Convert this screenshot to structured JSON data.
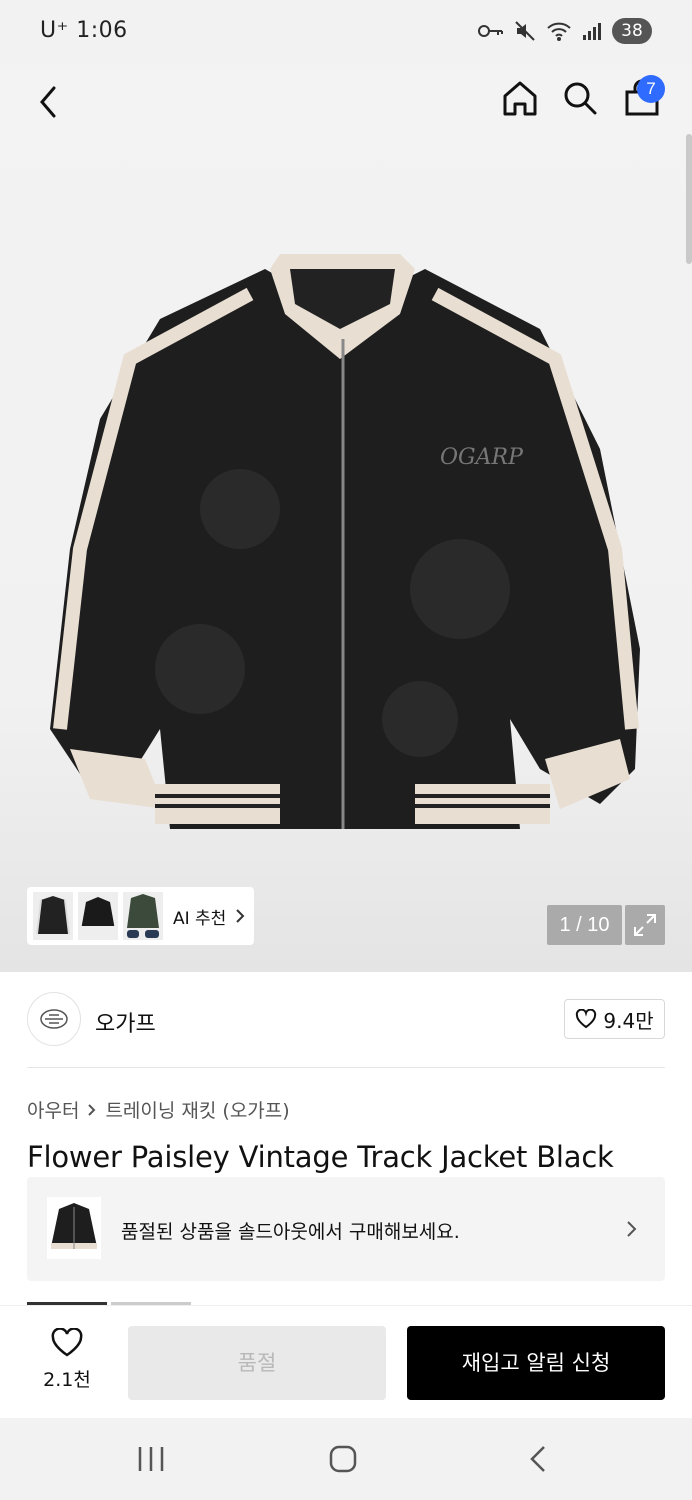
{
  "status": {
    "carrier": "U⁺ 1:06",
    "battery": "38"
  },
  "nav": {
    "cart_count": "7"
  },
  "gallery": {
    "counter": "1 / 10",
    "ai_label": "AI 추천"
  },
  "brand": {
    "name": "오가프",
    "likes": "9.4만"
  },
  "breadcrumb": {
    "category": "아우터",
    "subcategory": "트레이닝 재킷 (오가프)"
  },
  "product": {
    "title": "Flower Paisley Vintage Track Jacket Black"
  },
  "soldout_notice": {
    "text": "품절된 상품을 솔드아웃에서 구매해보세요."
  },
  "bottom": {
    "wish_count": "2.1천",
    "soldout_label": "품절",
    "restock_label": "재입고 알림 신청"
  },
  "colors": {
    "accent_badge": "#2f6bff",
    "primary_button": "#000000",
    "disabled_button": "#e9e9e9"
  }
}
